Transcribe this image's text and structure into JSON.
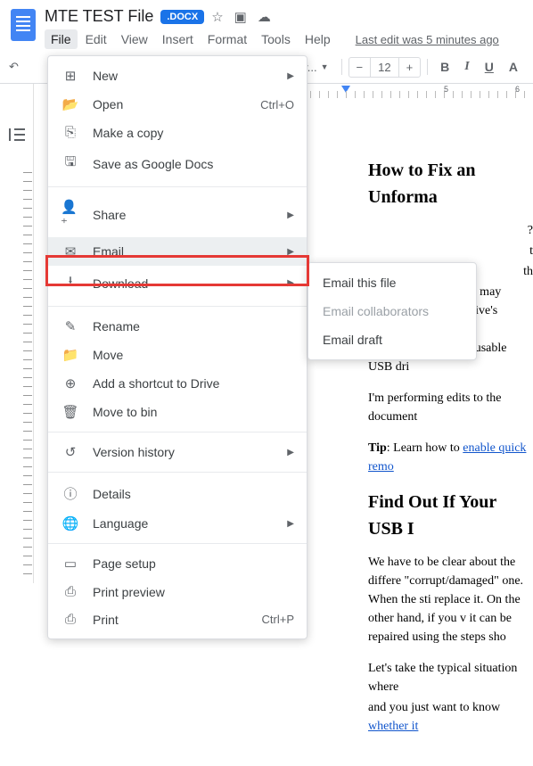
{
  "header": {
    "title": "MTE TEST File",
    "badge": ".DOCX",
    "menus": [
      "File",
      "Edit",
      "View",
      "Insert",
      "Format",
      "Tools",
      "Help"
    ],
    "last_edit": "Last edit was 5 minutes ago"
  },
  "toolbar": {
    "font": "nes New...",
    "font_size": "12",
    "bold": "B",
    "italic": "I",
    "underline": "U",
    "highlight": "A"
  },
  "file_menu": {
    "groups": [
      [
        {
          "icon": "⊞",
          "label": "New",
          "chevron": true
        },
        {
          "icon": "📂",
          "label": "Open",
          "shortcut": "Ctrl+O"
        },
        {
          "icon": "⎘",
          "label": "Make a copy"
        },
        {
          "icon": "🖫",
          "label": "Save as Google Docs"
        }
      ],
      [
        {
          "icon": "👤⁺",
          "label": "Share",
          "chevron": true
        },
        {
          "icon": "✉",
          "label": "Email",
          "chevron": true,
          "highlighted": true
        },
        {
          "icon": "⭳",
          "label": "Download",
          "chevron": true
        }
      ],
      [
        {
          "icon": "✎",
          "label": "Rename"
        },
        {
          "icon": "📁",
          "label": "Move"
        },
        {
          "icon": "⊕",
          "label": "Add a shortcut to Drive"
        },
        {
          "icon": "🗑",
          "label": "Move to bin"
        }
      ],
      [
        {
          "icon": "↺",
          "label": "Version history",
          "chevron": true
        }
      ],
      [
        {
          "icon": "ⓘ",
          "label": "Details"
        },
        {
          "icon": "🌐",
          "label": "Language",
          "chevron": true
        }
      ],
      [
        {
          "icon": "▭",
          "label": "Page setup"
        },
        {
          "icon": "⎙",
          "label": "Print preview"
        },
        {
          "icon": "⎙",
          "label": "Print",
          "shortcut": "Ctrl+P"
        }
      ]
    ]
  },
  "email_submenu": [
    {
      "label": "Email this file"
    },
    {
      "label": "Email collaborators",
      "disabled": true
    },
    {
      "label": "Email draft"
    }
  ],
  "document": {
    "h1": "How to Fix an Unforma",
    "p1_frag1": "?",
    "p1_frag2": "t",
    "p1_frag3": "th",
    "p2": "are many reasons you may experience the pen drive's storage space. Follow unformattable and unusable USB dri",
    "p3": "I'm performing edits to the document",
    "p4_prefix": "Tip",
    "p4_rest": ": Learn how to ",
    "p4_link": "enable quick remo",
    "h2": "Find Out If Your USB I",
    "p5": "We have to be clear about the differe \"corrupt/damaged\" one. When the sti replace it. On the other hand, if you v it can be repaired using the steps sho",
    "p6": "Let's take the typical situation where",
    "p7_pre": "and you just want to know ",
    "p7_link": "whether it"
  }
}
